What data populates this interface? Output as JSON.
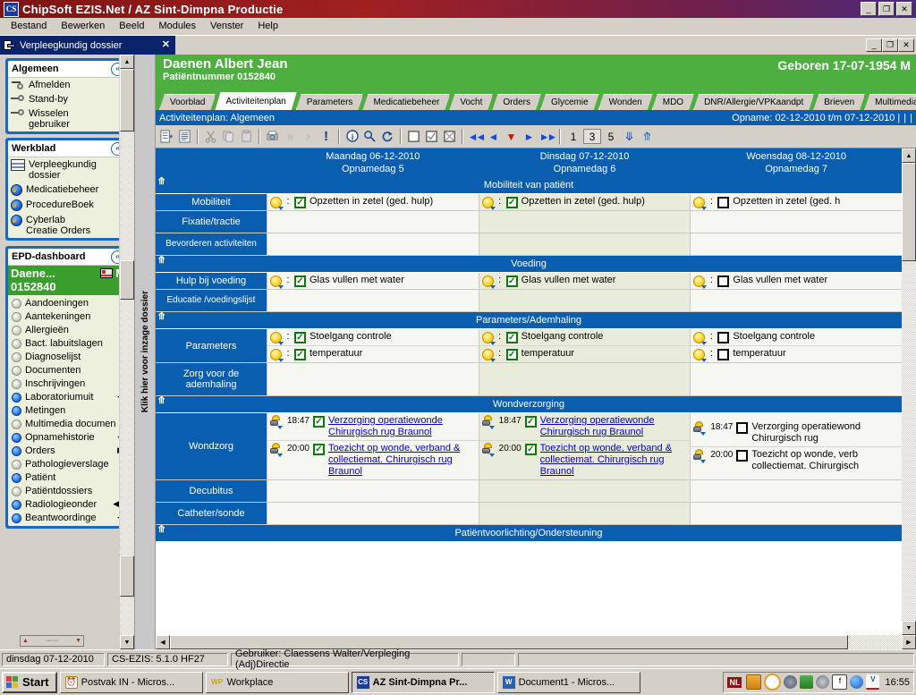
{
  "window": {
    "title": "ChipSoft EZIS.Net / AZ Sint-Dimpna Productie",
    "logo_text": "CS",
    "minimize": "_",
    "maximize": "❐",
    "close": "✕"
  },
  "menubar": [
    "Bestand",
    "Bewerken",
    "Beeld",
    "Modules",
    "Venster",
    "Help"
  ],
  "mdi_tab": {
    "label": "Verpleegkundig dossier",
    "close": "✕",
    "minimize": "_",
    "maximize": "❐",
    "restore_close": "✕"
  },
  "sidebar": {
    "panels": [
      {
        "title": "Algemeen",
        "collapse_icon": "«",
        "items": [
          {
            "label": "Afmelden",
            "icon": "arrow-key-icon"
          },
          {
            "label": "Stand-by",
            "icon": "key-icon"
          },
          {
            "label": "Wisselen\ngebruiker",
            "icon": "key-icon"
          }
        ]
      },
      {
        "title": "Werkblad",
        "collapse_icon": "«",
        "items": [
          {
            "label": "Verpleegkundig\ndossier",
            "icon": "book-icon"
          },
          {
            "label": "Medicatiebeheer",
            "icon": "globe-icon"
          },
          {
            "label": "ProcedureBoek",
            "icon": "globe-icon"
          },
          {
            "label": "Cyberlab\nCreatie Orders",
            "icon": "globe-icon"
          }
        ]
      }
    ],
    "dashboard": {
      "title": "EPD-dashboard",
      "collapse_icon": "«",
      "patient_name": "Daene...",
      "patient_gender": "M",
      "patient_number": "0152840",
      "bed_icon": "bed-icon",
      "items": [
        {
          "label": "Aandoeningen",
          "active": false,
          "nav": ""
        },
        {
          "label": "Aantekeningen",
          "active": false,
          "nav": ""
        },
        {
          "label": "Allergieën",
          "active": false,
          "nav": ""
        },
        {
          "label": "Bact. labuitslagen",
          "active": false,
          "nav": ""
        },
        {
          "label": "Diagnoselijst",
          "active": false,
          "nav": ""
        },
        {
          "label": "Documenten",
          "active": false,
          "nav": ""
        },
        {
          "label": "Inschrijvingen",
          "active": false,
          "nav": ""
        },
        {
          "label": "Laboratoriumuit",
          "active": true,
          "nav": "◀◀"
        },
        {
          "label": "Metingen",
          "active": true,
          "nav": ""
        },
        {
          "label": "Multimedia documen",
          "active": false,
          "nav": ""
        },
        {
          "label": "Opnamehistorie",
          "active": true,
          "nav": "◀◀"
        },
        {
          "label": "Orders",
          "active": true,
          "nav": "▶▶"
        },
        {
          "label": "Pathologieverslage",
          "active": false,
          "nav": ""
        },
        {
          "label": "Patiënt",
          "active": true,
          "nav": ""
        },
        {
          "label": "Patiëntdossiers",
          "active": false,
          "nav": ""
        },
        {
          "label": "Radiologieonder",
          "active": true,
          "nav": "◀◀◀"
        },
        {
          "label": "Beantwoordinge",
          "active": true,
          "nav": "◀▶"
        }
      ]
    }
  },
  "vertical_strip": {
    "label": "Klik hier voor inzage dossier"
  },
  "patient_header": {
    "name": "Daenen Albert Jean",
    "patient_number_label": "Patiëntnummer 0152840",
    "born": "Geboren 17-07-1954 M"
  },
  "tabs": [
    {
      "label": "Voorblad",
      "active": false
    },
    {
      "label": "Activiteitenplan",
      "active": true
    },
    {
      "label": "Parameters",
      "active": false
    },
    {
      "label": "Medicatiebeheer",
      "active": false
    },
    {
      "label": "Vocht",
      "active": false
    },
    {
      "label": "Orders",
      "active": false
    },
    {
      "label": "Glycemie",
      "active": false
    },
    {
      "label": "Wonden",
      "active": false
    },
    {
      "label": "MDO",
      "active": false
    },
    {
      "label": "DNR/Allergie/VPKaandpt",
      "active": false
    },
    {
      "label": "Brieven",
      "active": false
    },
    {
      "label": "Multimedia",
      "active": false
    }
  ],
  "panel": {
    "title": "Activiteitenplan: Algemeen",
    "admission": "Opname: 02-12-2010 t/m 07-12-2010 |",
    "pipe1": "|",
    "pipe2": "|"
  },
  "toolbar": {
    "buttons": [
      {
        "name": "new-record-icon",
        "glyph": "▤"
      },
      {
        "name": "list-view-icon",
        "glyph": "☰"
      },
      {
        "name": "cut-icon",
        "glyph": "✂"
      },
      {
        "name": "copy-icon",
        "glyph": "❐"
      },
      {
        "name": "paste-icon",
        "glyph": "📋"
      },
      {
        "name": "print-icon",
        "glyph": "⎙"
      },
      {
        "name": "fast-forward-icon",
        "glyph": "»"
      },
      {
        "name": "forward-icon",
        "glyph": "›"
      },
      {
        "name": "alert-icon",
        "glyph": "!"
      },
      {
        "name": "info-icon",
        "glyph": "i"
      },
      {
        "name": "search-icon",
        "glyph": "⚲"
      },
      {
        "name": "refresh-icon",
        "glyph": "↺"
      },
      {
        "name": "unchecked-box-icon",
        "glyph": "☐"
      },
      {
        "name": "checked-box-icon",
        "glyph": "☑"
      },
      {
        "name": "crossed-box-icon",
        "glyph": "☒"
      }
    ],
    "nav": [
      {
        "name": "nav-first-icon",
        "glyph": "◀◀"
      },
      {
        "name": "nav-prev-icon",
        "glyph": "◀"
      },
      {
        "name": "nav-today-icon",
        "glyph": "▼"
      },
      {
        "name": "nav-next-icon",
        "glyph": "▶"
      },
      {
        "name": "nav-last-icon",
        "glyph": "▶▶"
      }
    ],
    "day_counts": [
      {
        "value": "1",
        "selected": false
      },
      {
        "value": "3",
        "selected": true
      },
      {
        "value": "5",
        "selected": false
      }
    ],
    "expand_all_icon": "»",
    "collapse_all_icon": "«"
  },
  "grid": {
    "columns": [
      {
        "date": "Maandag 06-12-2010",
        "day": "Opnamedag 5"
      },
      {
        "date": "Dinsdag 07-12-2010",
        "day": "Opnamedag 6"
      },
      {
        "date": "Woensdag 08-12-2010",
        "day": "Opnamedag 7"
      }
    ],
    "sections": [
      {
        "title": "Mobiliteit van patiënt",
        "rows": [
          {
            "label": "Mobiliteit",
            "cells": [
              [
                {
                  "icon": "sun-icon",
                  "sep": ":",
                  "checked": true,
                  "text": "Opzetten in zetel (ged. hulp)",
                  "link": false
                }
              ],
              [
                {
                  "icon": "sun-icon",
                  "sep": ":",
                  "checked": true,
                  "text": "Opzetten in zetel (ged. hulp)",
                  "link": false
                }
              ],
              [
                {
                  "icon": "sun-icon",
                  "sep": ":",
                  "checked": false,
                  "text": "Opzetten in zetel (ged. h",
                  "link": false
                }
              ]
            ]
          },
          {
            "label": "Fixatie/tractie",
            "cells": [
              [],
              [],
              []
            ]
          },
          {
            "label": "Bevorderen activiteiten",
            "cells": [
              [],
              [],
              []
            ]
          }
        ]
      },
      {
        "title": "Voeding",
        "rows": [
          {
            "label": "Hulp bij voeding",
            "cells": [
              [
                {
                  "icon": "sun-icon",
                  "sep": ":",
                  "checked": true,
                  "text": "Glas vullen met water",
                  "link": false
                }
              ],
              [
                {
                  "icon": "sun-icon",
                  "sep": ":",
                  "checked": true,
                  "text": "Glas vullen met water",
                  "link": false
                }
              ],
              [
                {
                  "icon": "sun-icon",
                  "sep": ":",
                  "checked": false,
                  "text": "Glas vullen met water",
                  "link": false
                }
              ]
            ]
          },
          {
            "label": "Educatie /voedingslijst",
            "cells": [
              [],
              [],
              []
            ]
          }
        ]
      },
      {
        "title": "Parameters/Ademhaling",
        "rows": [
          {
            "label": "Parameters",
            "cells": [
              [
                {
                  "icon": "sun-icon",
                  "sep": ":",
                  "checked": true,
                  "text": "Stoelgang controle",
                  "link": false
                },
                {
                  "icon": "sun-icon",
                  "sep": ":",
                  "checked": true,
                  "text": "temperatuur",
                  "link": false
                }
              ],
              [
                {
                  "icon": "sun-icon",
                  "sep": ":",
                  "checked": true,
                  "text": "Stoelgang controle",
                  "link": false
                },
                {
                  "icon": "sun-icon",
                  "sep": ":",
                  "checked": true,
                  "text": "temperatuur",
                  "link": false
                }
              ],
              [
                {
                  "icon": "sun-icon",
                  "sep": ":",
                  "checked": false,
                  "text": "Stoelgang controle",
                  "link": false
                },
                {
                  "icon": "sun-icon",
                  "sep": ":",
                  "checked": false,
                  "text": "temperatuur",
                  "link": false
                }
              ]
            ]
          },
          {
            "label": "Zorg voor de\nademhaling",
            "cells": [
              [],
              [],
              []
            ]
          }
        ]
      },
      {
        "title": "Wondverzorging",
        "rows": [
          {
            "label": "Wondzorg",
            "cells": [
              [
                {
                  "icon": "moon-icon",
                  "time": "18:47",
                  "checked": true,
                  "text": "Verzorging operatiewonde Chirurgisch rug  Braunol",
                  "link": true
                },
                {
                  "icon": "moon-icon",
                  "time": "20:00",
                  "checked": true,
                  "text": "Toezicht op wonde, verband & collectiemat. Chirurgisch rug  Braunol",
                  "link": true
                }
              ],
              [
                {
                  "icon": "moon-icon",
                  "time": "18:47",
                  "checked": true,
                  "text": "Verzorging operatiewonde Chirurgisch rug  Braunol",
                  "link": true
                },
                {
                  "icon": "moon-icon",
                  "time": "20:00",
                  "checked": true,
                  "text": "Toezicht op wonde, verband & collectiemat. Chirurgisch rug  Braunol",
                  "link": true
                }
              ],
              [
                {
                  "icon": "moon-icon",
                  "time": "18:47",
                  "checked": false,
                  "text": "Verzorging operatiewond Chirurgisch rug",
                  "link": false
                },
                {
                  "icon": "moon-icon",
                  "time": "20:00",
                  "checked": false,
                  "text": "Toezicht op wonde, verb collectiemat. Chirurgisch",
                  "link": false
                }
              ]
            ]
          },
          {
            "label": "Decubitus",
            "cells": [
              [],
              [],
              []
            ]
          },
          {
            "label": "Catheter/sonde",
            "cells": [
              [],
              [],
              []
            ]
          }
        ]
      },
      {
        "title": "Patiëntvoorlichting/Ondersteuning",
        "rows": []
      }
    ]
  },
  "statusbar": {
    "date": "dinsdag 07-12-2010",
    "version": "CS-EZIS: 5.1.0 HF27",
    "user": "Gebruiker: Claessens Walter/Verpleging (Adj)Directie",
    "extra": ""
  },
  "taskbar": {
    "start_label": "Start",
    "items": [
      {
        "label": "Postvak IN - Micros...",
        "icon": "outlook-icon",
        "active": false
      },
      {
        "label": "Workplace",
        "icon": "workplace-icon",
        "active": false
      },
      {
        "label": "AZ Sint-Dimpna Pr...",
        "icon": "chipsoft-icon",
        "active": true
      },
      {
        "label": "Document1 - Micros...",
        "icon": "word-icon",
        "active": false
      }
    ],
    "tray": {
      "language": "NL",
      "icons": [
        "java-icon",
        "clock-icon",
        "volume-icon",
        "printer-icon",
        "update-icon",
        "font-icon",
        "network-icon",
        "virus-icon"
      ],
      "clock": "16:55"
    }
  }
}
